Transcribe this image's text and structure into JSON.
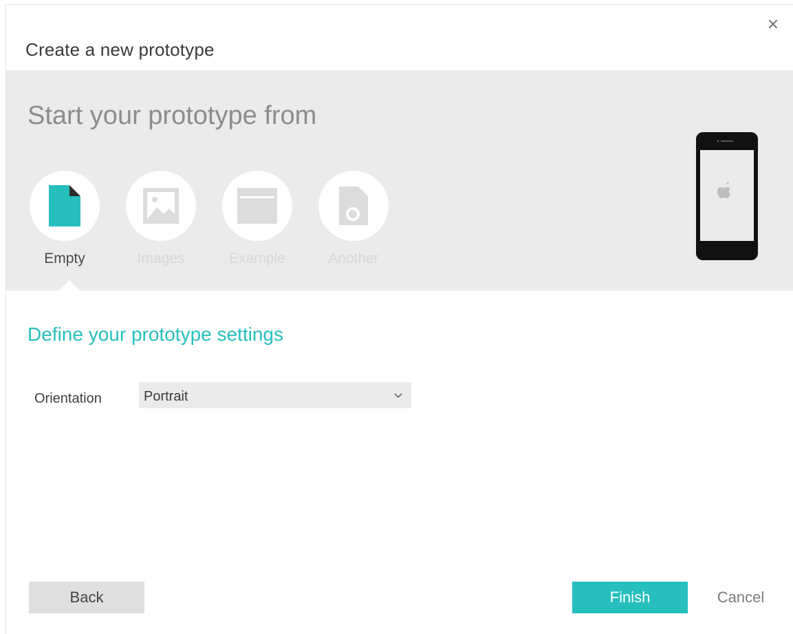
{
  "dialog": {
    "title": "Create a new prototype",
    "close_icon": "close-icon",
    "source_heading": "Start your prototype from",
    "options": [
      {
        "label": "Empty",
        "icon": "document-icon",
        "active": true
      },
      {
        "label": "Images",
        "icon": "image-icon",
        "active": false
      },
      {
        "label": "Example",
        "icon": "window-icon",
        "active": false
      },
      {
        "label": "Another",
        "icon": "file-record-icon",
        "active": false
      }
    ],
    "device_icon": "iphone-icon",
    "settings_heading": "Define your prototype settings",
    "orientation": {
      "label": "Orientation",
      "value": "Portrait",
      "chevron_icon": "chevron-down-icon"
    },
    "buttons": {
      "back": "Back",
      "finish": "Finish",
      "cancel": "Cancel"
    }
  },
  "colors": {
    "accent": "#26bfbd",
    "panel_bg": "#ebebeb",
    "inactive_icon": "#dcdcdc"
  }
}
